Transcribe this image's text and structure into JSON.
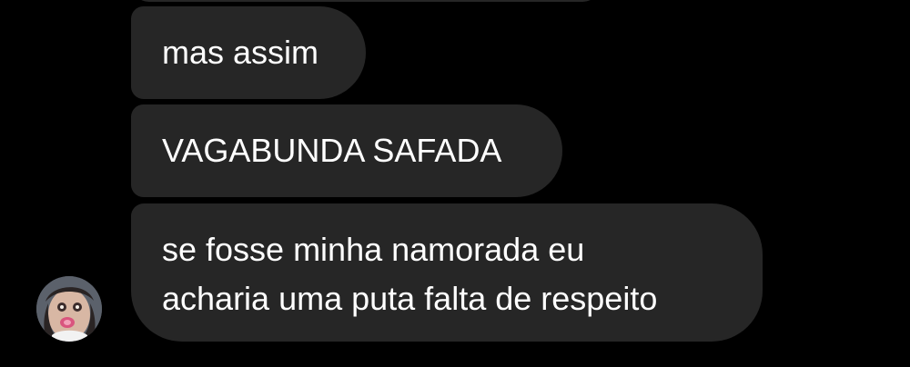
{
  "messages": [
    {
      "text": "mas assim"
    },
    {
      "text": "VAGABUNDA SAFADA"
    },
    {
      "lines": [
        "se fosse minha namorada eu",
        "acharia uma puta falta de respeito"
      ]
    }
  ],
  "colors": {
    "background": "#000000",
    "bubble": "#262626",
    "text": "#ffffff"
  },
  "avatar": {
    "icon": "profile-photo"
  }
}
